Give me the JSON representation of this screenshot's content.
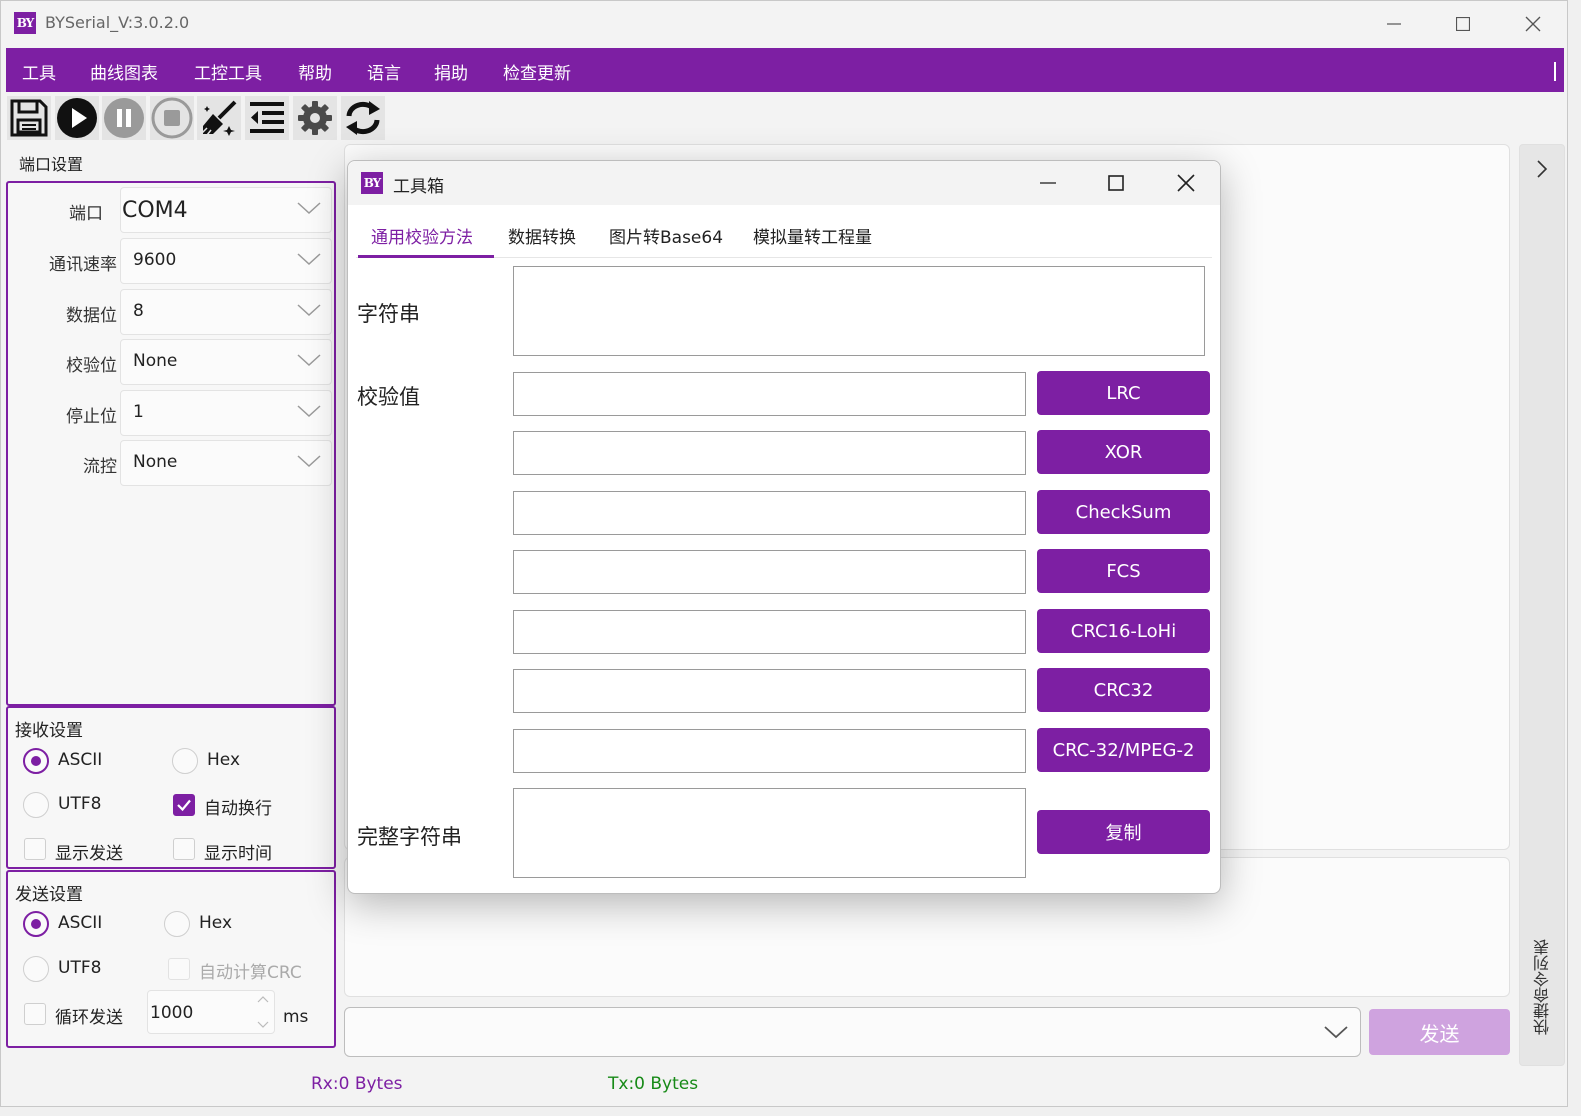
{
  "app": {
    "title": "BYSerial_V:3.0.2.0",
    "logo": "BY",
    "accent_color": "#7d1fa3"
  },
  "window_controls": [
    "minimize-icon",
    "maximize-icon",
    "close-icon"
  ],
  "menu": {
    "items": [
      "工具",
      "曲线图表",
      "工控工具",
      "帮助",
      "语言",
      "捐助",
      "检查更新"
    ]
  },
  "toolbar": {
    "icons": [
      "save-icon",
      "play-icon",
      "pause-icon",
      "stop-icon",
      "broom-icon",
      "indent-icon",
      "gear-icon",
      "refresh-icon"
    ]
  },
  "port_settings": {
    "title": "端口设置",
    "fields": [
      {
        "label": "端口",
        "value": "COM4"
      },
      {
        "label": "通讯速率",
        "value": "9600"
      },
      {
        "label": "数据位",
        "value": "8"
      },
      {
        "label": "校验位",
        "value": "None"
      },
      {
        "label": "停止位",
        "value": "1"
      },
      {
        "label": "流控",
        "value": "None"
      }
    ]
  },
  "receive_settings": {
    "title": "接收设置",
    "ascii": "ASCII",
    "hex": "Hex",
    "utf8": "UTF8",
    "auto_newline": "自动换行",
    "show_send": "显示发送",
    "show_time": "显示时间",
    "selected": "ASCII",
    "auto_newline_checked": true
  },
  "send_settings": {
    "title": "发送设置",
    "ascii": "ASCII",
    "hex": "Hex",
    "utf8": "UTF8",
    "auto_crc": "自动计算CRC",
    "loop_send": "循环发送",
    "interval": "1000",
    "unit": "ms",
    "selected": "ASCII"
  },
  "send": {
    "button": "发送",
    "input_value": ""
  },
  "side_panel": {
    "label": "快捷命令列表"
  },
  "status": {
    "rx": "Rx:0 Bytes",
    "tx": "Tx:0 Bytes"
  },
  "toolbox": {
    "title": "工具箱",
    "logo": "BY",
    "tabs": [
      "通用校验方法",
      "数据转换",
      "图片转Base64",
      "模拟量转工程量"
    ],
    "active_tab": "通用校验方法",
    "string_label": "字符串",
    "check_label": "校验值",
    "full_label": "完整字符串",
    "methods": [
      "LRC",
      "XOR",
      "CheckSum",
      "FCS",
      "CRC16-LoHi",
      "CRC32",
      "CRC-32/MPEG-2"
    ],
    "copy_button": "复制"
  }
}
